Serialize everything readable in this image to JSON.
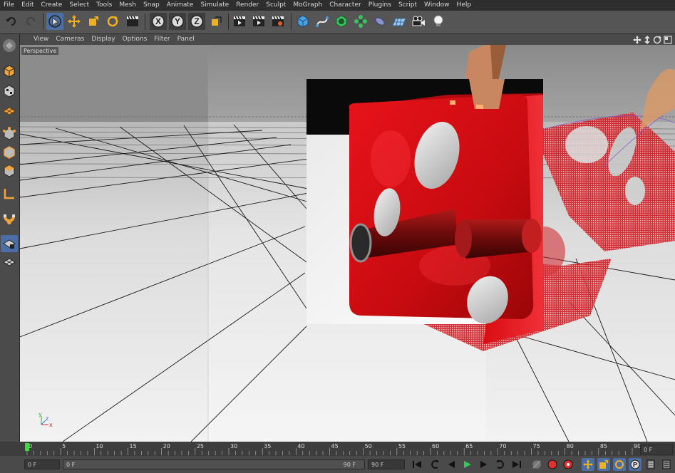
{
  "menu": [
    "File",
    "Edit",
    "Create",
    "Select",
    "Tools",
    "Mesh",
    "Snap",
    "Animate",
    "Simulate",
    "Render",
    "Sculpt",
    "MoGraph",
    "Character",
    "Plugins",
    "Script",
    "Window",
    "Help"
  ],
  "toolbar": {
    "undo_icon": "undo-icon",
    "axis_x": "X",
    "axis_y": "Y",
    "axis_z": "Z"
  },
  "viewport_menu": [
    "View",
    "Cameras",
    "Display",
    "Options",
    "Filter",
    "Panel"
  ],
  "viewport": {
    "label": "Perspective",
    "axis_x": "x",
    "axis_y": "y",
    "axis_z": "z"
  },
  "timeline": {
    "ticks": [
      "0",
      "5",
      "10",
      "15",
      "20",
      "25",
      "30",
      "35",
      "40",
      "45",
      "50",
      "55",
      "60",
      "65",
      "70",
      "75",
      "80",
      "85",
      "90"
    ],
    "current_frame": "0 F"
  },
  "controls": {
    "start_frame": "0 F",
    "min_frame": "0 F",
    "max_frame": "90 F",
    "end_frame": "90 F"
  },
  "colors": {
    "accent": "#4a6ea5",
    "die_red": "#d10f14",
    "timeline_marker": "#3cdc3c"
  }
}
